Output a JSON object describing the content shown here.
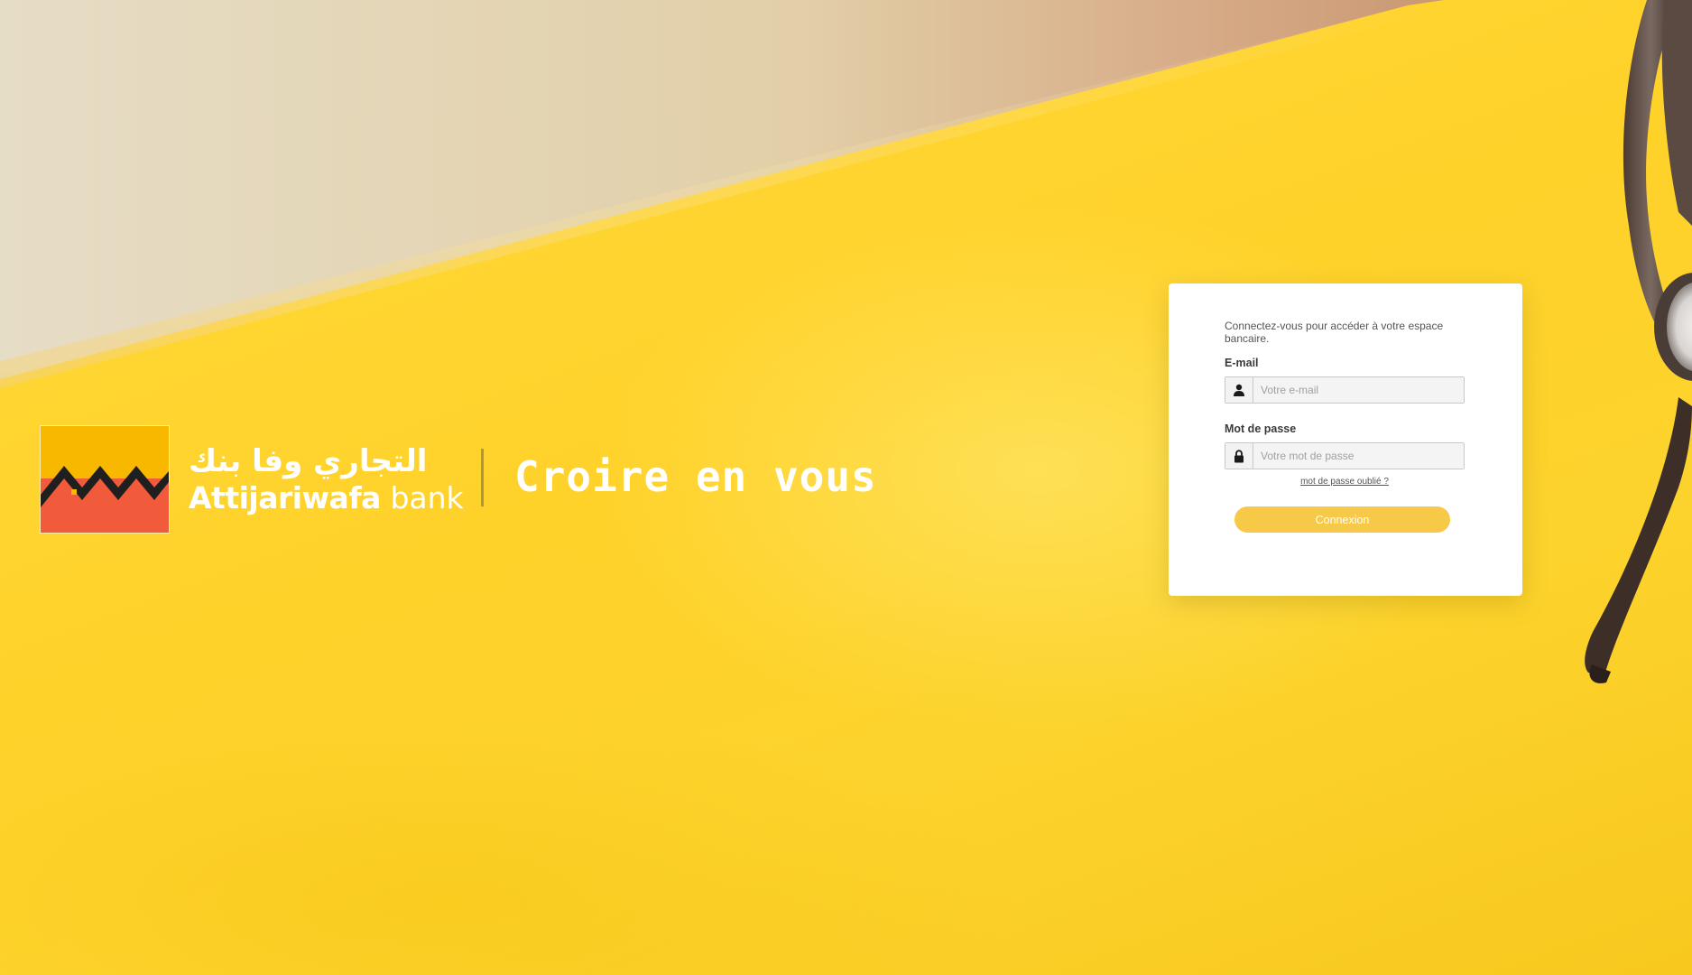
{
  "brand": {
    "arabic_name": "التجاري وفا بنك",
    "name_bold": "Attijariwafa",
    "name_light": " bank",
    "slogan": "Croire en vous",
    "colors": {
      "logo_yellow": "#f9b800",
      "logo_orange": "#f15a3a",
      "logo_dark": "#1f1f1f"
    }
  },
  "login": {
    "intro": "Connectez-vous pour accéder à votre espace bancaire.",
    "email_label": "E-mail",
    "email_placeholder": "Votre e-mail",
    "email_icon": "user-icon",
    "password_label": "Mot de passe",
    "password_placeholder": "Votre mot de passe",
    "password_icon": "lock-icon",
    "forgot_link": "mot de passe oublié ?",
    "submit_label": "Connexion",
    "button_color": "#f7c948"
  },
  "background": {
    "primary_color": "#ffd22a",
    "beige_color": "#e6dcc3"
  }
}
